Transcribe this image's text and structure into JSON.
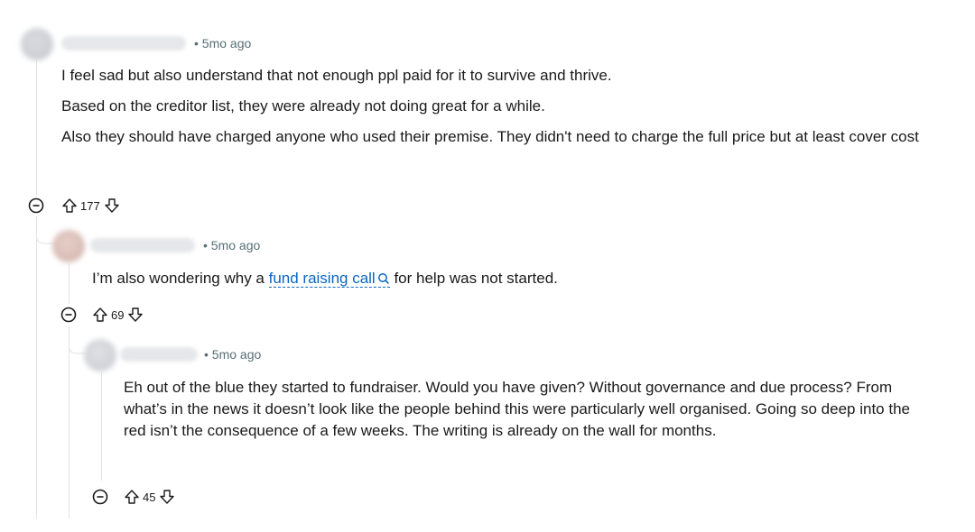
{
  "comments": [
    {
      "meta": "• 5mo ago",
      "paragraphs": [
        "I feel sad but also understand that not enough ppl paid for it to survive and thrive.",
        "Based on the creditor list, they were already not doing great for a while.",
        "Also they should have charged anyone who used their premise. They didn't need to charge the full price but at least cover cost"
      ],
      "score": "177"
    },
    {
      "meta": "• 5mo ago",
      "text_before": "I’m also wondering why a ",
      "link_text": "fund raising call",
      "text_after": " for help was not started.",
      "score": "69"
    },
    {
      "meta": "• 5mo ago",
      "paragraphs": [
        "Eh out of the blue they started to fundraiser. Would you have given? Without governance and due process? From what’s in the news it doesn’t look like the people behind this were particularly well organised. Going so deep into the red isn’t the consequence of a few weeks. The writing is already on the wall for months."
      ],
      "score": "45"
    }
  ],
  "icons": {
    "collapse": "minus-circle-icon",
    "upvote": "upvote-arrow-icon",
    "downvote": "downvote-arrow-icon",
    "search": "search-icon"
  },
  "colors": {
    "link": "#0a66c2",
    "meta": "#576f76",
    "thread_line": "#e1e3e6"
  }
}
